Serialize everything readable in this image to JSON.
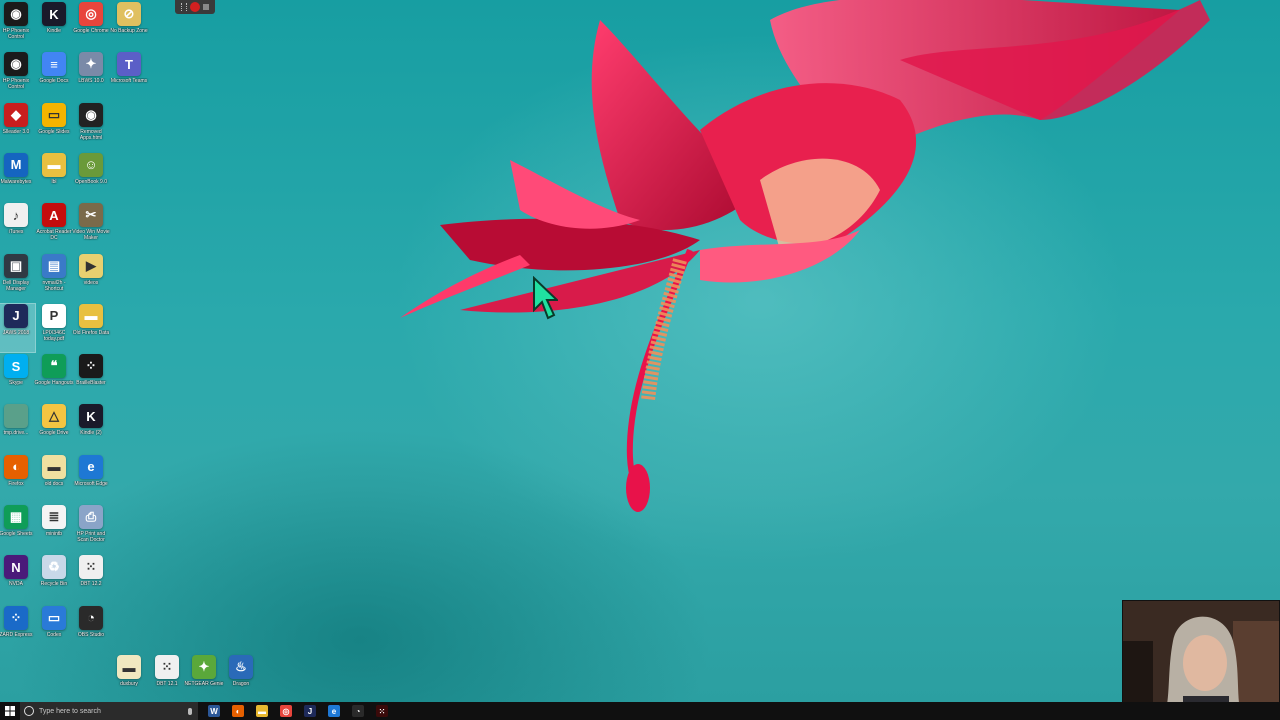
{
  "desktop": {
    "icons": [
      {
        "label": "HP Phoenix Control",
        "icon": "hp-phoenix-icon",
        "bg": "#1b1b1b",
        "glyph": "◉"
      },
      {
        "label": "Kindle",
        "icon": "kindle-icon",
        "bg": "#1a1a2a",
        "glyph": "K"
      },
      {
        "label": "Google Chrome",
        "icon": "chrome-icon",
        "bg": "#e8453c",
        "glyph": "◎"
      },
      {
        "label": "No Backup Zone",
        "icon": "no-backup-folder-icon",
        "bg": "#e0c060",
        "glyph": "⊘"
      },
      {
        "label": "HP Phoenix Control",
        "icon": "hp-phoenix-icon",
        "bg": "#1b1b1b",
        "glyph": "◉"
      },
      {
        "label": "Google Docs",
        "icon": "google-docs-icon",
        "bg": "#4285f4",
        "glyph": "≡"
      },
      {
        "label": "LBWS 10.0",
        "icon": "lbws-icon",
        "bg": "#7a8aa8",
        "glyph": "✦"
      },
      {
        "label": "Microsoft Teams",
        "icon": "teams-icon",
        "bg": "#5b5fc7",
        "glyph": "T"
      },
      {
        "label": "Slleader 3.0",
        "icon": "slleader-icon",
        "bg": "#c81e1e",
        "glyph": "◆"
      },
      {
        "label": "Google Slides",
        "icon": "google-slides-icon",
        "bg": "#f4b400",
        "glyph": "▭"
      },
      {
        "label": "Removed Apps.html",
        "icon": "html-file-icon",
        "bg": "#222222",
        "glyph": "◉"
      },
      {
        "label": "Malwarebytes",
        "icon": "malwarebytes-icon",
        "bg": "#1565c0",
        "glyph": "M"
      },
      {
        "label": "lbl",
        "icon": "folder-icon",
        "bg": "#e8c040",
        "glyph": "▬"
      },
      {
        "label": "OpenBook 9.0",
        "icon": "openbook-icon",
        "bg": "#6a9a3a",
        "glyph": "☺"
      },
      {
        "label": "iTunes",
        "icon": "itunes-icon",
        "bg": "#f0f0f0",
        "glyph": "♪"
      },
      {
        "label": "Acrobat Reader DC",
        "icon": "acrobat-icon",
        "bg": "#c40d0d",
        "glyph": "A"
      },
      {
        "label": "Video Win Movie Maker",
        "icon": "movie-maker-icon",
        "bg": "#7a6a4a",
        "glyph": "✂"
      },
      {
        "label": "Dell Display Manager",
        "icon": "dell-display-icon",
        "bg": "#303a44",
        "glyph": "▣"
      },
      {
        "label": "nvmail2h - Shortcut",
        "icon": "shortcut-icon",
        "bg": "#3a7ac8",
        "glyph": "▤"
      },
      {
        "label": "videos",
        "icon": "folder-icon",
        "bg": "#e8d070",
        "glyph": "▶"
      },
      {
        "label": "JAWS 2018",
        "icon": "jaws-icon",
        "bg": "#1e2a5a",
        "glyph": "J"
      },
      {
        "label": "LPIX346C today.pdf",
        "icon": "pdf-icon",
        "bg": "#ffffff",
        "glyph": "P"
      },
      {
        "label": "Old Firefox Data",
        "icon": "folder-icon",
        "bg": "#e8c040",
        "glyph": "▬"
      },
      {
        "label": "Skype",
        "icon": "skype-icon",
        "bg": "#00aff0",
        "glyph": "S"
      },
      {
        "label": "Google Hangouts",
        "icon": "hangouts-icon",
        "bg": "#0f9d58",
        "glyph": "❝"
      },
      {
        "label": "BrailleBlaster",
        "icon": "brailleblaster-icon",
        "bg": "#1a1a1a",
        "glyph": "⁘"
      },
      {
        "label": "tmp.drive...",
        "icon": "blank-file-icon",
        "bg": "#5aa08a",
        "glyph": " "
      },
      {
        "label": "Google Drive",
        "icon": "google-drive-icon",
        "bg": "#f4c542",
        "glyph": "△"
      },
      {
        "label": "Kindle (2)",
        "icon": "kindle-icon",
        "bg": "#1a1a2a",
        "glyph": "K"
      },
      {
        "label": "Firefox",
        "icon": "firefox-icon",
        "bg": "#e66000",
        "glyph": "◐"
      },
      {
        "label": "old docs",
        "icon": "folder-icon",
        "bg": "#f0e0a0",
        "glyph": "▬"
      },
      {
        "label": "Microsoft Edge",
        "icon": "edge-icon",
        "bg": "#1e78d4",
        "glyph": "e"
      },
      {
        "label": "Google Sheets",
        "icon": "google-sheets-icon",
        "bg": "#0f9d58",
        "glyph": "▦"
      },
      {
        "label": "minintb",
        "icon": "text-file-icon",
        "bg": "#f4f4f4",
        "glyph": "≣"
      },
      {
        "label": "HP Print and Scan Doctor",
        "icon": "hp-print-scan-icon",
        "bg": "#8aa4c8",
        "glyph": "⎙"
      },
      {
        "label": "NVDA",
        "icon": "nvda-icon",
        "bg": "#4a1a7a",
        "glyph": "N"
      },
      {
        "label": "Recycle Bin",
        "icon": "recycle-bin-icon",
        "bg": "#c8d8e8",
        "glyph": "♻"
      },
      {
        "label": "DBT 12.2",
        "icon": "dbt-icon",
        "bg": "#f0f0f0",
        "glyph": "⁙"
      },
      {
        "label": "ZARD Express",
        "icon": "zard-icon",
        "bg": "#1a6ac8",
        "glyph": "⁘"
      },
      {
        "label": "Codex",
        "icon": "codex-icon",
        "bg": "#2a7ad8",
        "glyph": "▭"
      },
      {
        "label": "OBS Studio",
        "icon": "obs-icon",
        "bg": "#2a2a2a",
        "glyph": "◔"
      }
    ],
    "bottom_icons": [
      {
        "label": "duxbury",
        "icon": "text-file-icon",
        "bg": "#f0e8c0",
        "glyph": "▬"
      },
      {
        "label": "DBT 12.1",
        "icon": "dbt-icon",
        "bg": "#f0f0f0",
        "glyph": "⁙"
      },
      {
        "label": "NETGEAR Genie",
        "icon": "netgear-genie-icon",
        "bg": "#5aa83a",
        "glyph": "✦"
      },
      {
        "label": "Dragon",
        "icon": "dragon-icon",
        "bg": "#2a6ab8",
        "glyph": "♨"
      }
    ]
  },
  "taskbar": {
    "search_placeholder": "Type here to search",
    "apps": [
      {
        "icon": "word-icon",
        "bg": "#2b5797",
        "glyph": "W"
      },
      {
        "icon": "firefox-icon",
        "bg": "#e66000",
        "glyph": "◐"
      },
      {
        "icon": "file-explorer-icon",
        "bg": "#e8b830",
        "glyph": "▬"
      },
      {
        "icon": "chrome-icon",
        "bg": "#e8453c",
        "glyph": "◎"
      },
      {
        "icon": "jaws-icon",
        "bg": "#1e2a5a",
        "glyph": "J"
      },
      {
        "icon": "edge-icon",
        "bg": "#1e78d4",
        "glyph": "e"
      },
      {
        "icon": "obs-icon",
        "bg": "#2a2a2a",
        "glyph": "◔"
      },
      {
        "icon": "dbt-icon",
        "bg": "#3a0a0a",
        "glyph": "⁙"
      }
    ]
  },
  "colors": {
    "desktop_bg": "#2aa0a3",
    "flower": "#d81b4a",
    "taskbar": "#101010"
  }
}
